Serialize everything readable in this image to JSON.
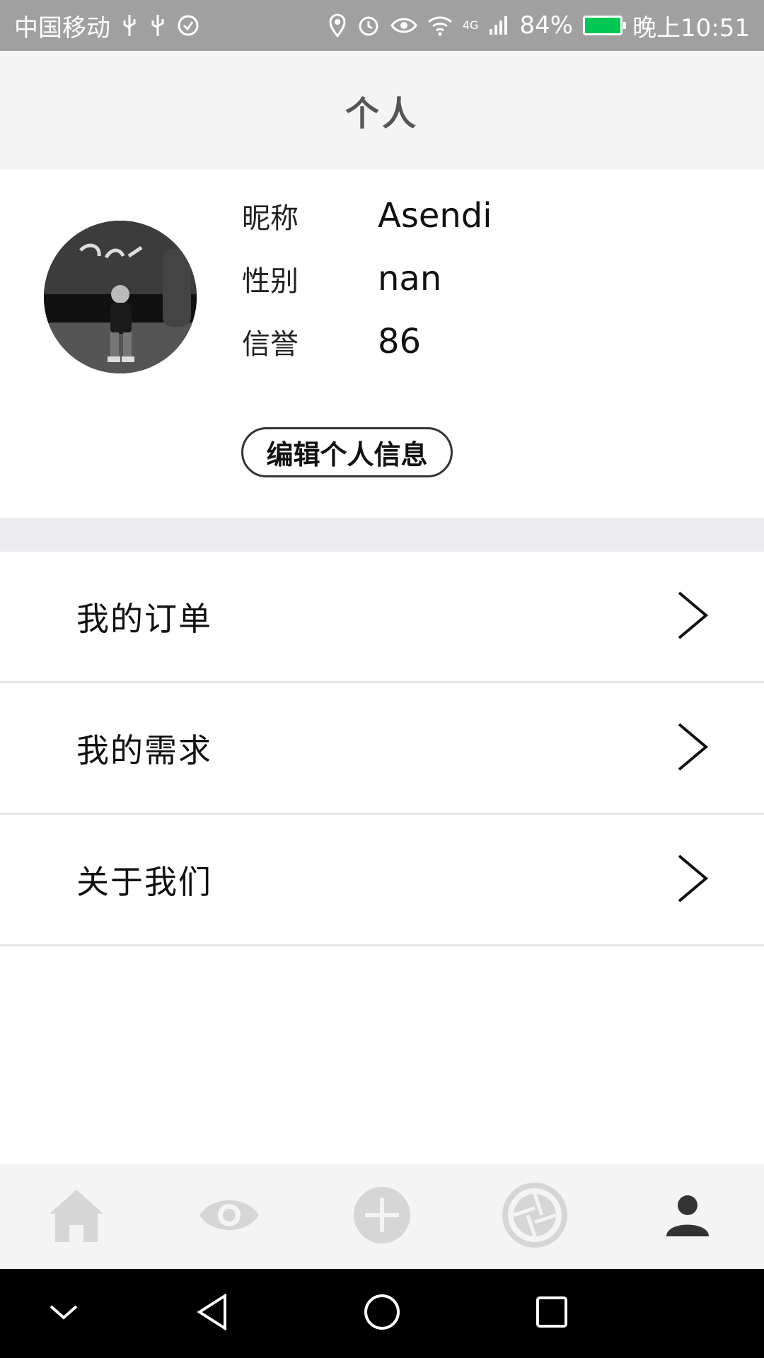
{
  "status_bar": {
    "carrier": "中国移动",
    "network": "4G",
    "battery": "84%",
    "time": "晚上10:51",
    "icons": [
      "usb-icon",
      "usb-icon",
      "sync-icon",
      "location-icon",
      "alarm-icon",
      "eye-icon",
      "wifi-icon",
      "signal-icon",
      "battery-icon"
    ]
  },
  "header": {
    "title": "个人"
  },
  "profile": {
    "nickname_label": "昵称",
    "nickname": "Asendi",
    "gender_label": "性别",
    "gender": "nan",
    "credit_label": "信誉",
    "credit": "86",
    "edit_button": "编辑个人信息"
  },
  "menu": {
    "items": [
      {
        "label": "我的订单",
        "icon": "chevron-right-icon"
      },
      {
        "label": "我的需求",
        "icon": "chevron-right-icon"
      },
      {
        "label": "关于我们",
        "icon": "chevron-right-icon"
      }
    ]
  },
  "bottom_nav": {
    "items": [
      {
        "icon": "home-icon",
        "active": false
      },
      {
        "icon": "eye-icon",
        "active": false
      },
      {
        "icon": "plus-circle-icon",
        "active": false
      },
      {
        "icon": "camera-aperture-icon",
        "active": false
      },
      {
        "icon": "person-icon",
        "active": true
      }
    ],
    "active_color": "#333333",
    "inactive_color": "#d6d6d6"
  },
  "system_nav": {
    "icons": [
      "collapse-icon",
      "back-icon",
      "home-circle-icon",
      "recents-icon"
    ]
  }
}
